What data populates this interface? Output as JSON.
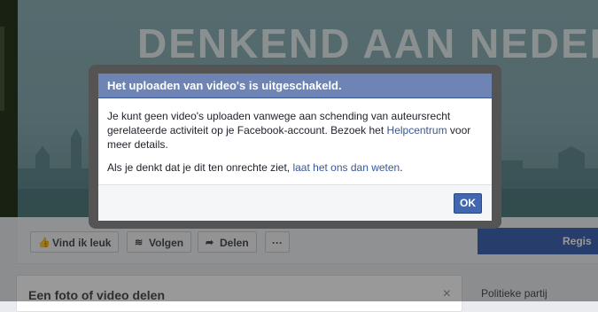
{
  "background": {
    "cover_title": "DENKEND AAN NEDERLA",
    "actions": {
      "like": "Vind ik leuk",
      "follow": "Volgen",
      "share": "Delen",
      "more": "···"
    },
    "register_label": "Regis",
    "share_card": {
      "title": "Een foto of video delen",
      "close": "×"
    },
    "sidebar_label": "Politieke partij"
  },
  "dialog": {
    "title": "Het uploaden van video's is uitgeschakeld.",
    "paragraph1_text": "Je kunt geen video's uploaden vanwege aan schending van auteursrecht gerelateerde activiteit op je Facebook-account. Bezoek het ",
    "paragraph1_link": "Helpcentrum",
    "paragraph1_suffix": " voor meer details.",
    "paragraph2_text": "Als je denkt dat je dit ten onrechte ziet, ",
    "paragraph2_link": "laat het ons dan weten",
    "paragraph2_suffix": ".",
    "ok_label": "OK"
  },
  "colors": {
    "header": "#6d84b4",
    "link": "#365899",
    "button": "#4267b2"
  }
}
